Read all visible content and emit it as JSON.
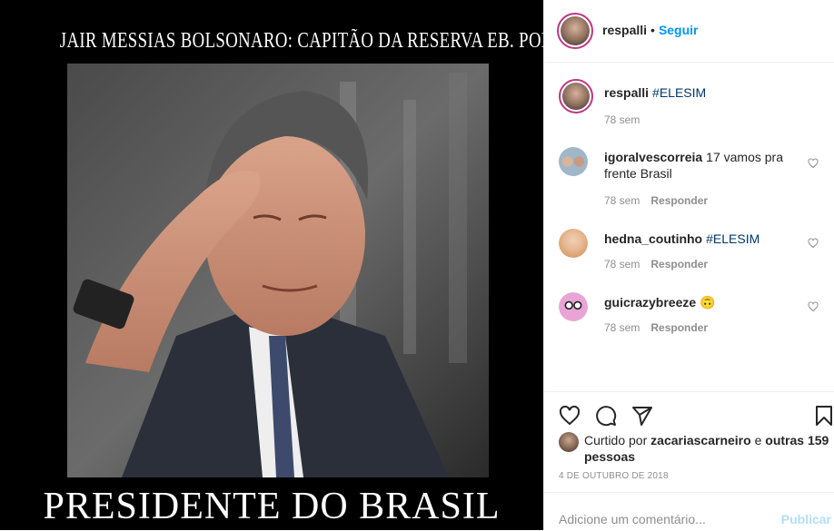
{
  "media": {
    "top_caption": "JAIR MESSIAS BOLSONARO: CAPITÃO DA RESERVA EB. POLÍTICO",
    "bottom_caption": "PRESIDENTE DO BRASIL"
  },
  "header": {
    "username": "respalli",
    "separator": "•",
    "follow_label": "Seguir"
  },
  "caption": {
    "username": "respalli",
    "text": "#ELESIM",
    "time": "78 sem"
  },
  "comments": [
    {
      "username": "igoralvescorreia",
      "text": "17 vamos pra frente Brasil",
      "time": "78 sem",
      "reply_label": "Responder"
    },
    {
      "username": "hedna_coutinho",
      "text": "#ELESIM",
      "time": "78 sem",
      "reply_label": "Responder"
    },
    {
      "username": "guicrazybreeze",
      "text": "🙃",
      "time": "78 sem",
      "reply_label": "Responder"
    }
  ],
  "actions": {
    "icons": [
      "heart-icon",
      "comment-icon",
      "share-icon",
      "bookmark-icon"
    ]
  },
  "likes": {
    "prefix": "Curtido por",
    "user": "zacariascarneiro",
    "conj": "e",
    "others": "outras 159 pessoas"
  },
  "date": "4 DE OUTUBRO DE 2018",
  "add_comment": {
    "placeholder": "Adicione um comentário...",
    "publish_label": "Publicar"
  },
  "colors": {
    "accent": "#0095f6",
    "hashtag": "#00376b",
    "muted": "#8e8e8e",
    "publish_disabled": "#b2dffc"
  }
}
